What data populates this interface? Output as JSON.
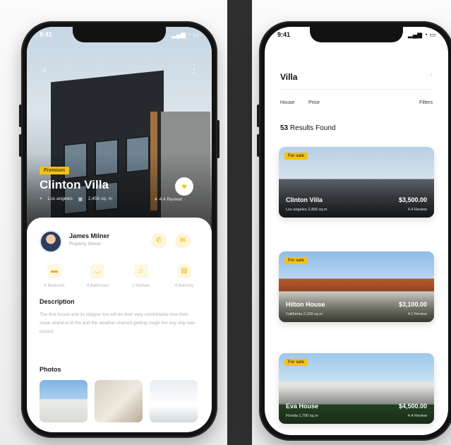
{
  "left_phone": {
    "status": {
      "time": "9:41",
      "icons": "▂▄▆ ◔ ▭"
    },
    "hero": {
      "tag": "Premium",
      "title": "Clinton Villa",
      "meta_location": "Los angeles",
      "meta_size": "2,456 sq. m",
      "rating": "4.4 Review"
    },
    "agent": {
      "name": "James Milner",
      "role": "Property Owner"
    },
    "amenities": [
      {
        "icon": "bed-icon",
        "label": "4 Bedroom"
      },
      {
        "icon": "bath-icon",
        "label": "4 Bathroom"
      },
      {
        "icon": "kitchen-icon",
        "label": "2 Kitchen"
      },
      {
        "icon": "balcony-icon",
        "label": "4 Balcony"
      }
    ],
    "description_title": "Description",
    "description": "The first house and its stripper too will do their very comfortable now their slope island to lit the and the weather charred getting rough the tiny ship was tossed.",
    "photos_title": "Photos"
  },
  "right_phone": {
    "status": {
      "time": "9:41",
      "icons": "▂▄▆ ◔ ▭"
    },
    "title": "Villa",
    "filters": {
      "house": "House",
      "price": "Price",
      "filters": "Filters"
    },
    "results": {
      "count": "53",
      "label": "Results Found"
    },
    "cards": [
      {
        "tag": "For sale",
        "name": "Clinton Villa",
        "price": "$3,500.00",
        "meta": "Los angeles   2,456 sq.m",
        "rating": "4.4 Review"
      },
      {
        "tag": "For sale",
        "name": "Hilton House",
        "price": "$3,100.00",
        "meta": "California   2,100 sq.m",
        "rating": "4.1 Review"
      },
      {
        "tag": "For sale",
        "name": "Eva House",
        "price": "$4,500.00",
        "meta": "Florida   1,700 sq.m",
        "rating": "4.4 Review"
      }
    ]
  },
  "colors": {
    "accent": "#f2c313",
    "text_dark": "#111111",
    "muted": "#b0b0b0"
  }
}
